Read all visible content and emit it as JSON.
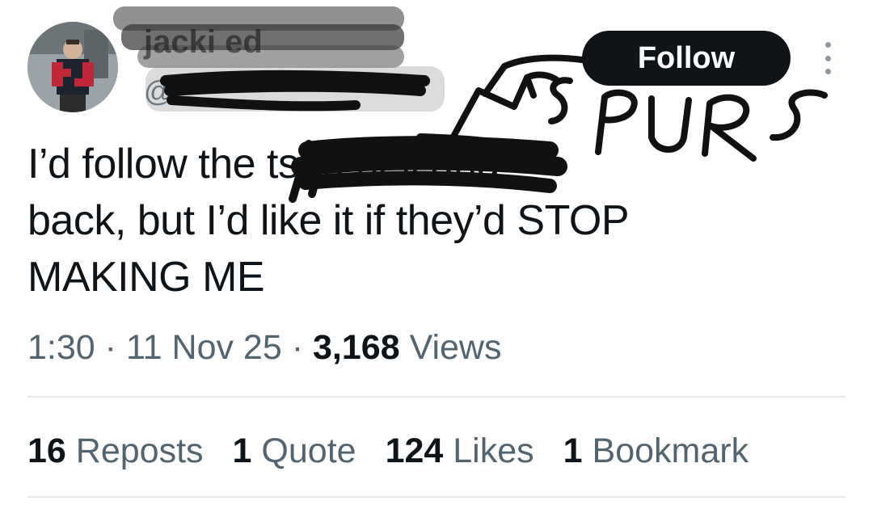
{
  "author": {
    "display_name": "jacki      ed",
    "handle": "@"
  },
  "follow_button_label": "Follow",
  "scribble_text": "SPURS",
  "tweet": {
    "line1": "I’d follow the                           ts to hell and",
    "line2": "back, but I’d like it if they’d STOP",
    "line3": "MAKING ME"
  },
  "meta": {
    "time": "1:30",
    "sep1": "·",
    "date": "11 Nov 25",
    "sep2": "·",
    "views_count": "3,168",
    "views_label": "Views"
  },
  "stats": [
    {
      "count": "16",
      "label": "Reposts"
    },
    {
      "count": "1",
      "label": "Quote"
    },
    {
      "count": "124",
      "label": "Likes"
    },
    {
      "count": "1",
      "label": "Bookmark"
    }
  ],
  "colors": {
    "text_primary": "#0f1419",
    "text_secondary": "#536471",
    "divider": "#e6e9eb",
    "button_bg": "#0f1419",
    "scribble_ink": "#111111"
  },
  "icons": {
    "more": "more-horizontal-dots-icon"
  }
}
